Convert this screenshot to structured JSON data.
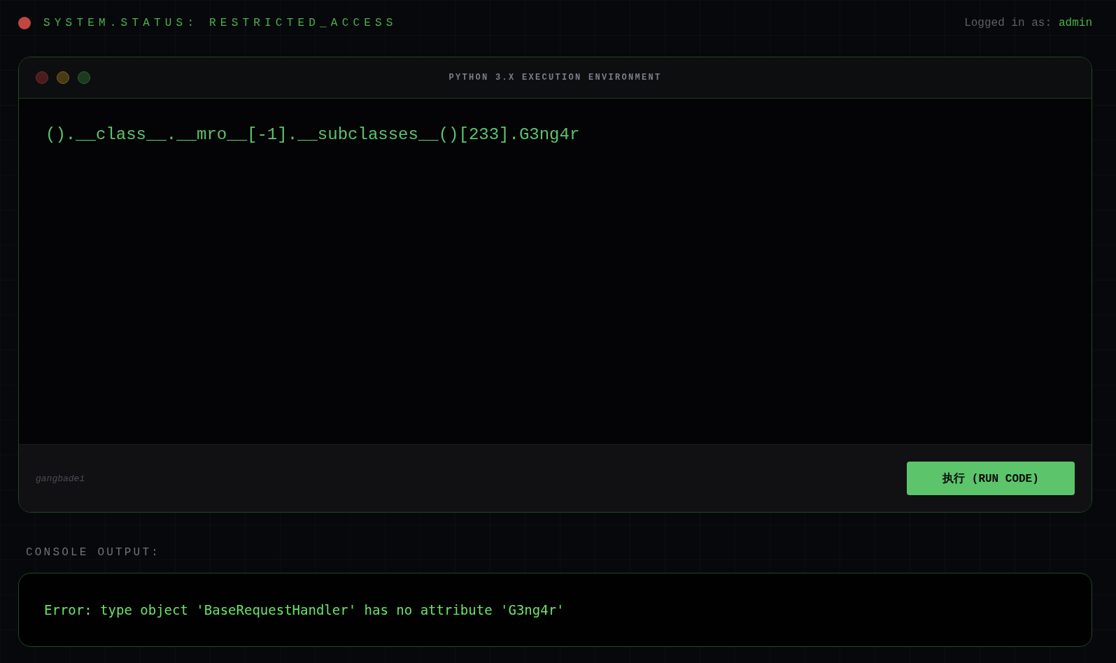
{
  "header": {
    "status": "SYSTEM.STATUS: RESTRICTED_ACCESS",
    "login_label": "Logged in as:",
    "user": "admin"
  },
  "editor": {
    "title": "PYTHON 3.X EXECUTION ENVIRONMENT",
    "code": "().__class__.__mro__[-1].__subclasses__()[233].G3ng4r",
    "footer_note": "gangbadei",
    "run_button": "执行 (RUN CODE)"
  },
  "console": {
    "label": "CONSOLE OUTPUT:",
    "output": "Error: type object 'BaseRequestHandler' has no attribute 'G3ng4r'"
  }
}
